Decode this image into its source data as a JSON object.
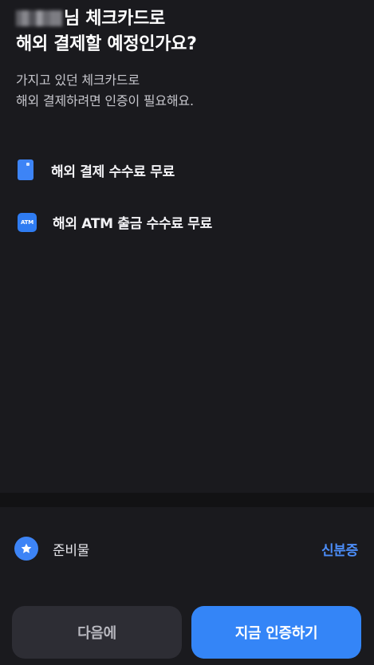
{
  "header": {
    "title_line1_suffix": "님 체크카드로",
    "title_line2": "해외 결제할 예정인가요?",
    "subtitle_line1": "가지고 있던 체크카드로",
    "subtitle_line2": "해외 결제하려면 인증이 필요해요."
  },
  "benefits": [
    {
      "icon": "card-icon",
      "label": "해외 결제 수수료 무료"
    },
    {
      "icon": "atm-icon",
      "icon_text": "ATM",
      "label": "해외 ATM 출금 수수료 무료"
    }
  ],
  "preparation": {
    "icon": "star-icon",
    "label": "준비물",
    "value": "신분증"
  },
  "buttons": {
    "later": "다음에",
    "verify": "지금 인증하기"
  },
  "colors": {
    "background": "#1a1a1e",
    "accent": "#3485f7",
    "secondary_button": "#2d2d34"
  }
}
